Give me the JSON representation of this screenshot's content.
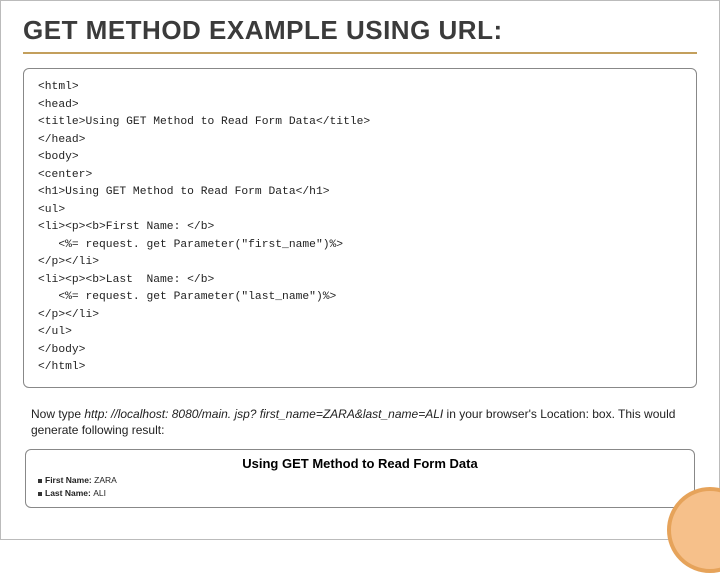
{
  "title": "GET METHOD EXAMPLE USING URL:",
  "code": "<html>\n<head>\n<title>Using GET Method to Read Form Data</title>\n</head>\n<body>\n<center>\n<h1>Using GET Method to Read Form Data</h1>\n<ul>\n<li><p><b>First Name: </b>\n   <%= request. get Parameter(\"first_name\")%>\n</p></li>\n<li><p><b>Last  Name: </b>\n   <%= request. get Parameter(\"last_name\")%>\n</p></li>\n</ul>\n</body>\n</html>",
  "instruction_pre": "Now type ",
  "instruction_url": "http: //localhost: 8080/main. jsp? first_name=ZARA&last_name=ALI",
  "instruction_post": " in your browser's Location: box. This would generate following result:",
  "result": {
    "heading": "Using GET Method to Read Form Data",
    "line1_label": "First Name: ",
    "line1_value": "ZARA",
    "line2_label": "Last Name: ",
    "line2_value": "ALI"
  }
}
